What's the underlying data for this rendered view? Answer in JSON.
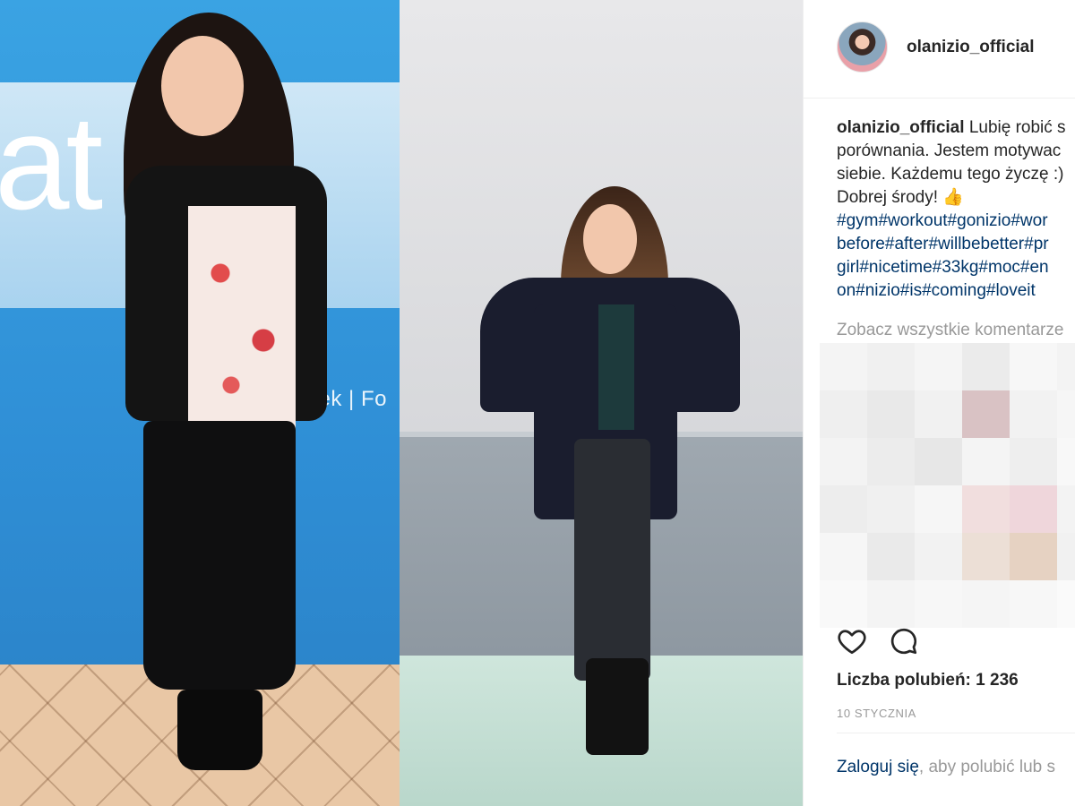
{
  "photo": {
    "left_banner_text": "at el",
    "left_caption": "Tomasz Raczek | Fo"
  },
  "post": {
    "username": "olanizio_official",
    "caption_lines": [
      "Lubię robić s",
      "porównania. Jestem motywac",
      "siebie. Każdemu tego życzę :)",
      "Dobrej środy! 👍"
    ],
    "hashtag_lines": [
      "#gym#workout#gonizio#wor",
      "before#after#willbebetter#pr",
      "girl#nicetime#33kg#moc#en",
      "on#nizio#is#coming#loveit"
    ],
    "view_comments": "Zobacz wszystkie komentarze",
    "likes": "Liczba polubień: 1 236",
    "date": "10 STYCZNIA",
    "login_link": "Zaloguj się",
    "login_rest": ", aby polubić lub s"
  },
  "icons": {
    "like": "heart-icon",
    "comment": "comment-icon"
  },
  "colors": {
    "hashtag": "#003569",
    "muted": "#999999",
    "text": "#262626"
  }
}
